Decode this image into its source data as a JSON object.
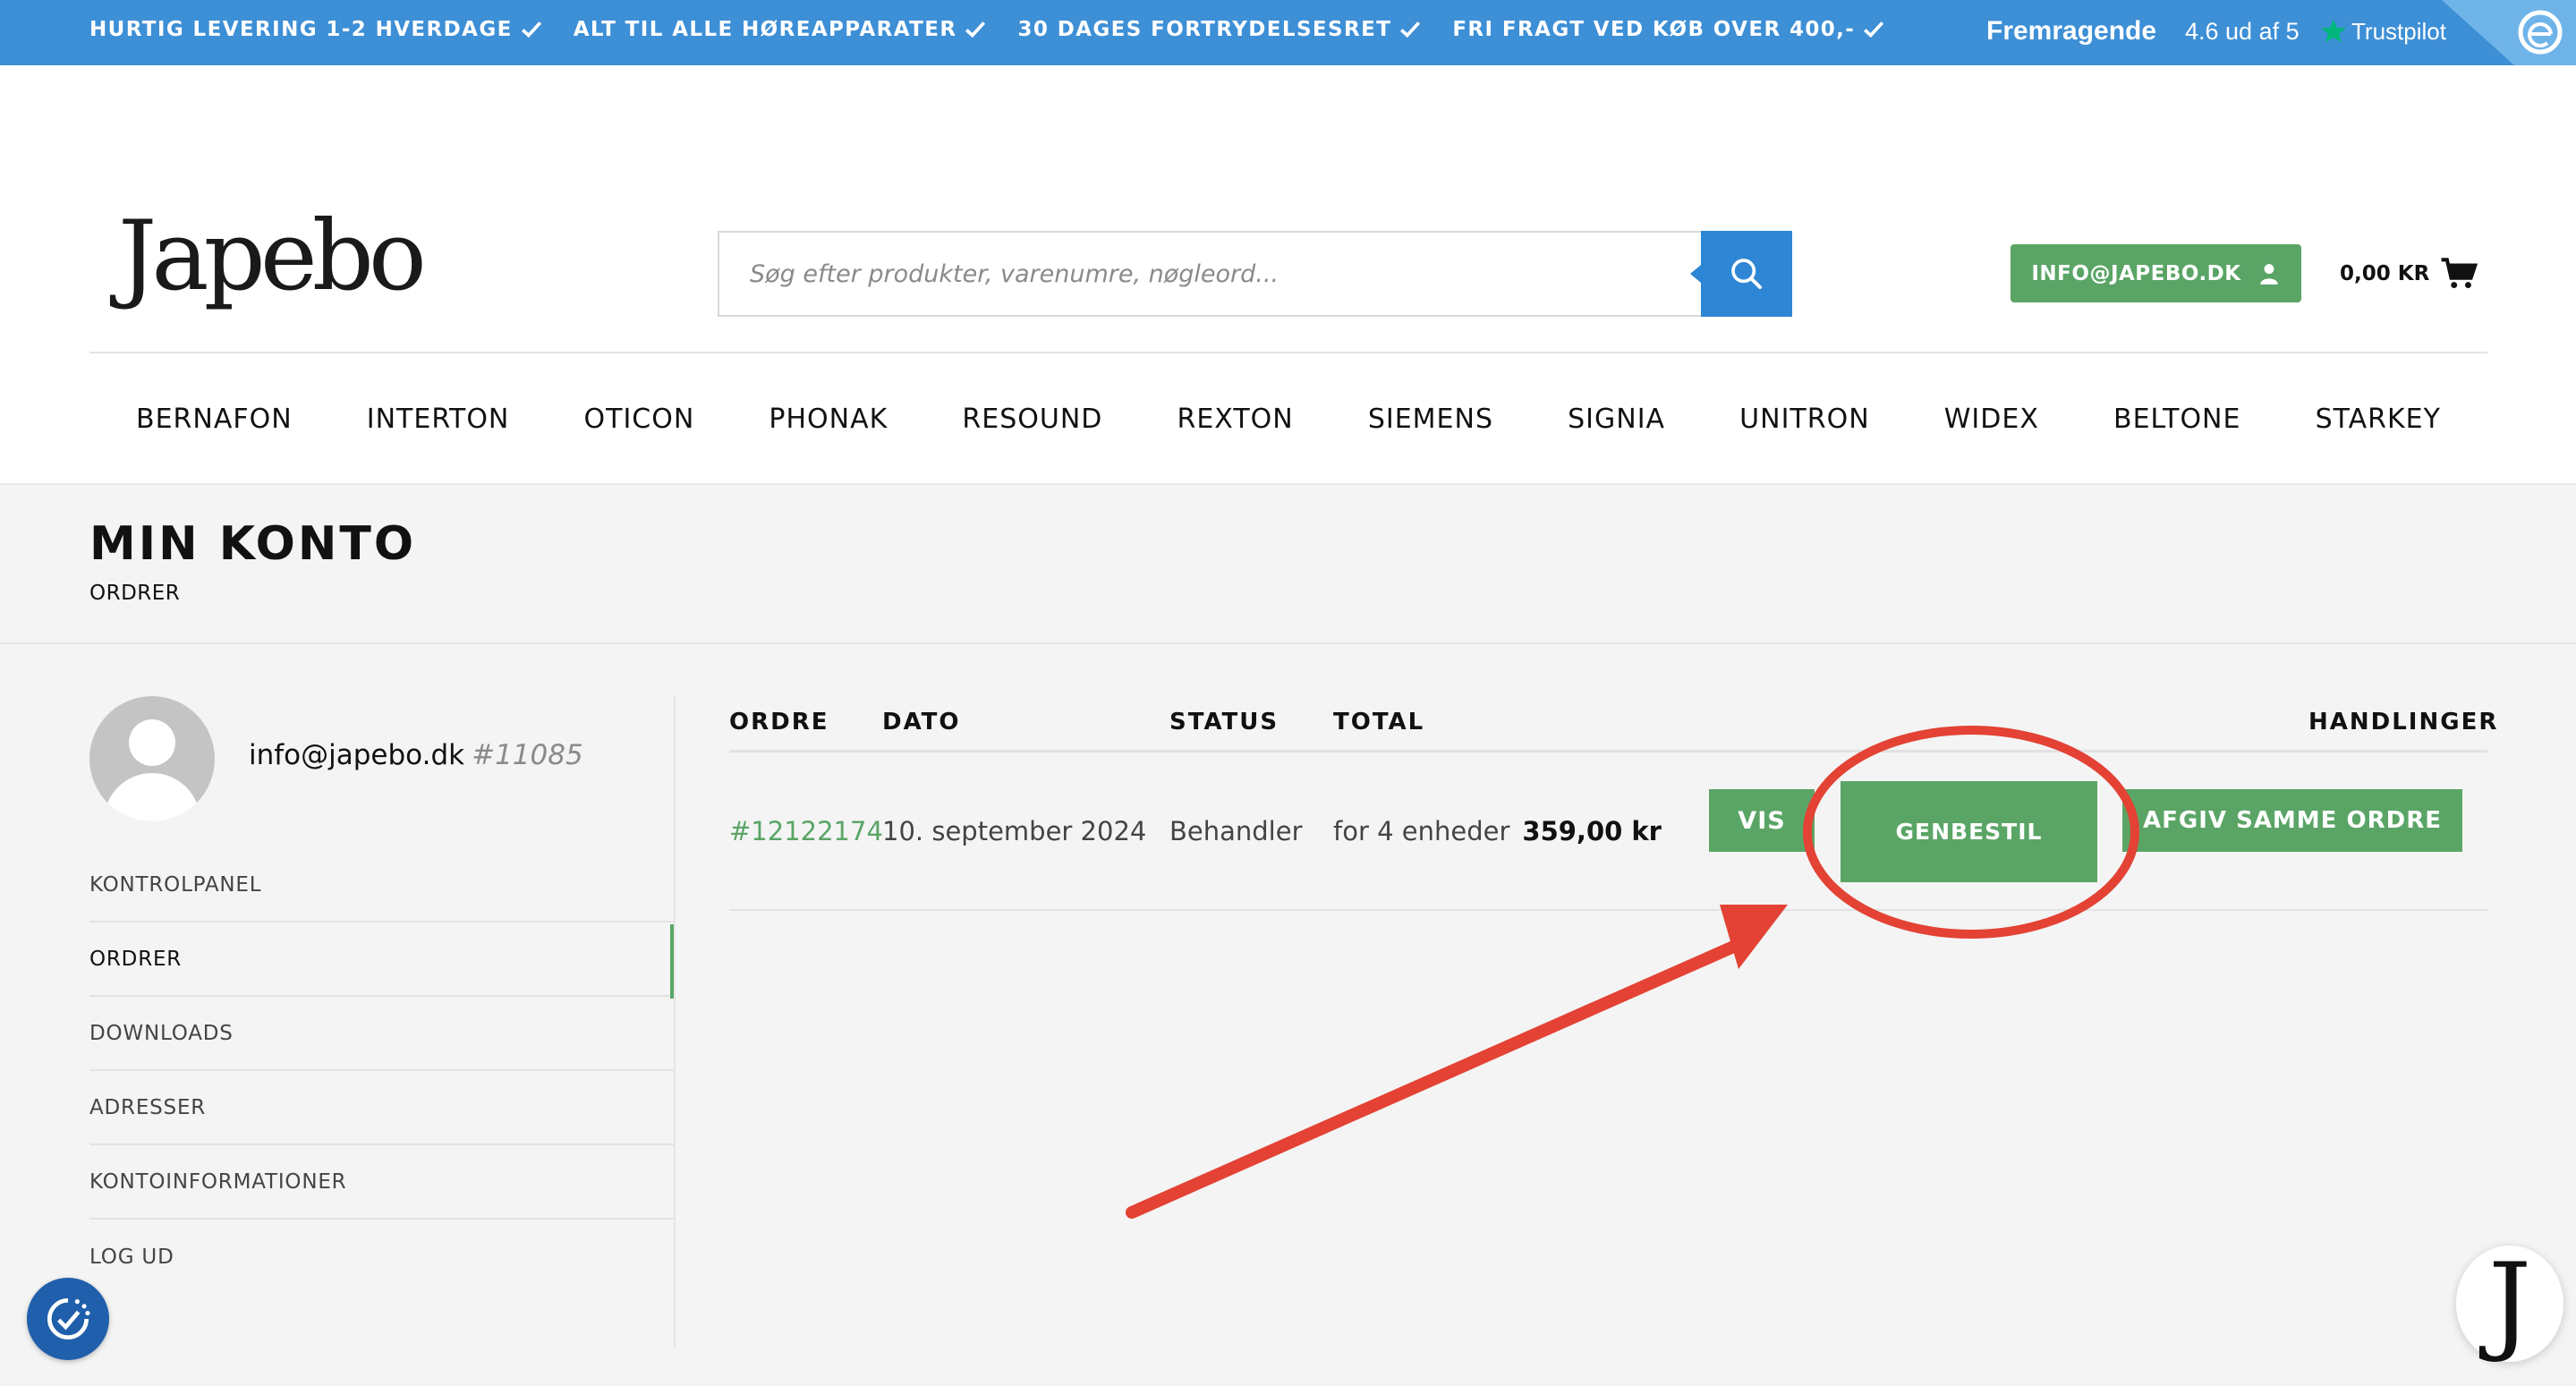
{
  "topbar": {
    "usps": [
      "HURTIG LEVERING 1-2 HVERDAGE",
      "ALT TIL ALLE HØREAPPARATER",
      "30 DAGES FORTRYDELSESRET",
      "FRI FRAGT VED KØB OVER 400,-"
    ],
    "trustpilot": {
      "rating_word": "Fremragende",
      "score": "4.6 ud af 5",
      "brand": "Trustpilot"
    }
  },
  "header": {
    "logo": "Japebo",
    "search_placeholder": "Søg efter produkter, varenumre, nøgleord...",
    "account_label": "INFO@JAPEBO.DK",
    "cart_total": "0,00 KR"
  },
  "brands": [
    "BERNAFON",
    "INTERTON",
    "OTICON",
    "PHONAK",
    "RESOUND",
    "REXTON",
    "SIEMENS",
    "SIGNIA",
    "UNITRON",
    "WIDEX",
    "BELTONE",
    "STARKEY"
  ],
  "page": {
    "title": "MIN KONTO",
    "breadcrumb": "ORDRER"
  },
  "user": {
    "email": "info@japebo.dk",
    "id": "#11085"
  },
  "sidebar": {
    "items": [
      "KONTROLPANEL",
      "ORDRER",
      "DOWNLOADS",
      "ADRESSER",
      "KONTOINFORMATIONER",
      "LOG UD"
    ],
    "active": "ORDRER"
  },
  "orders": {
    "headers": {
      "order": "ORDRE",
      "date": "DATO",
      "status": "STATUS",
      "total": "TOTAL",
      "actions": "HANDLINGER"
    },
    "rows": [
      {
        "number": "#12122174",
        "date": "10. september 2024",
        "status": "Behandler",
        "units": "for 4 enheder",
        "amount": "359,00 kr"
      }
    ],
    "actions": {
      "view": "VIS",
      "reorder": "GENBESTIL",
      "same_order": "AFGIV SAMME ORDRE"
    }
  },
  "widgets": {
    "chat_letter": "J"
  },
  "colors": {
    "topbar": "#3d8fd6",
    "accent_green": "#5aa566",
    "search_blue": "#2e86d4",
    "annotation_red": "#e34234",
    "a11y_blue": "#1f5fab"
  }
}
